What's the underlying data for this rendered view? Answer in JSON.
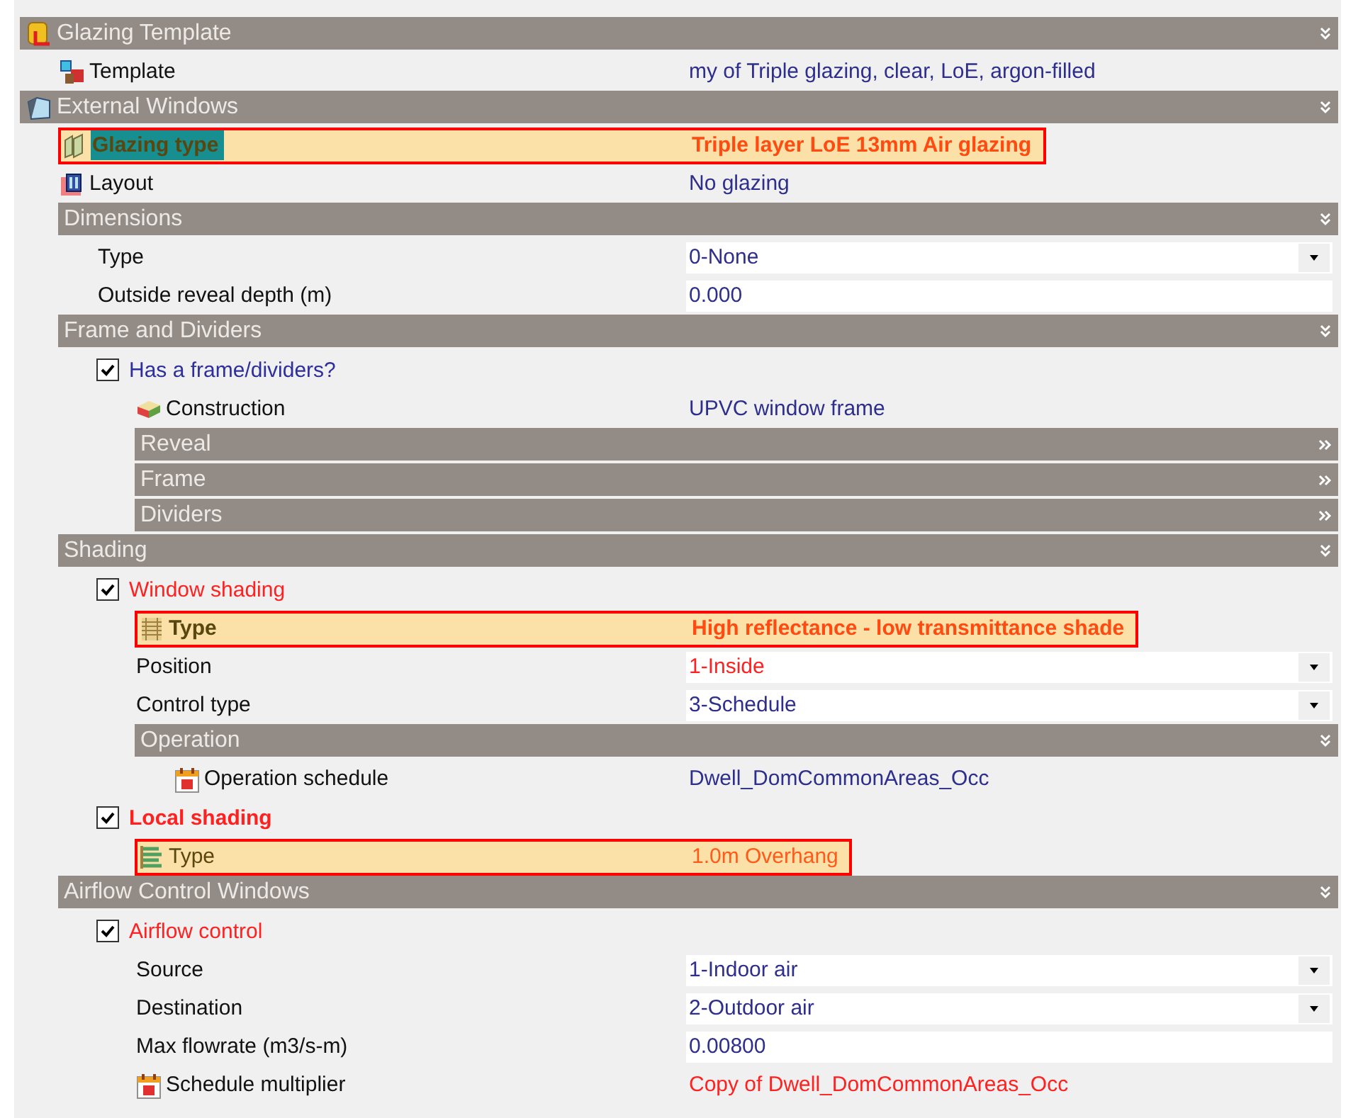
{
  "rows": [
    {
      "kind": "header",
      "label": "Glazing Template",
      "expanded": true,
      "children": [
        {
          "kind": "field",
          "label": "Template",
          "value": "my of Triple glazing, clear, LoE, argon-filled",
          "color": "#2e2e8c",
          "highlighted": false,
          "bold": false
        }
      ]
    },
    {
      "kind": "header",
      "label": "External Windows",
      "expanded": true,
      "children": [
        {
          "kind": "field",
          "label": "Glazing type",
          "value": "Triple layer LoE 13mm Air glazing",
          "color": "#ff4a10",
          "highlighted": true,
          "bold": true,
          "label_selected": true
        },
        {
          "kind": "field",
          "label": "Layout",
          "value": "No glazing",
          "color": "#2e2e8c",
          "highlighted": false,
          "bold": false
        },
        {
          "kind": "header",
          "label": "Dimensions",
          "expanded": true,
          "children": [
            {
              "kind": "dropdown",
              "label": "Type",
              "value": "0-None",
              "color": "#2e2e8c"
            },
            {
              "kind": "input",
              "label": "Outside reveal depth (m)",
              "value": "0.000",
              "color": "#2e2e8c"
            }
          ]
        },
        {
          "kind": "header",
          "label": "Frame and Dividers",
          "expanded": true,
          "children": [
            {
              "kind": "checkbox",
              "label": "Has a frame/dividers?",
              "checked": true,
              "color": "#2e2e9c",
              "bold": false,
              "children": [
                {
                  "kind": "field",
                  "label": "Construction",
                  "value": "UPVC window frame",
                  "color": "#2e2e8c",
                  "highlighted": false,
                  "bold": false
                },
                {
                  "kind": "header",
                  "label": "Reveal",
                  "expanded": false
                },
                {
                  "kind": "header",
                  "label": "Frame",
                  "expanded": false
                },
                {
                  "kind": "header",
                  "label": "Dividers",
                  "expanded": false
                }
              ]
            }
          ]
        },
        {
          "kind": "header",
          "label": "Shading",
          "expanded": true,
          "children": [
            {
              "kind": "checkbox",
              "label": "Window shading",
              "checked": true,
              "color": "#ff2020",
              "bold": false,
              "children": [
                {
                  "kind": "field",
                  "label": "Type",
                  "value": "High reflectance - low transmittance shade",
                  "color": "#ff4a10",
                  "highlighted": true,
                  "bold": true
                },
                {
                  "kind": "dropdown",
                  "label": "Position",
                  "value": "1-Inside",
                  "color": "#ff2020"
                },
                {
                  "kind": "dropdown",
                  "label": "Control type",
                  "value": "3-Schedule",
                  "color": "#2e2e8c"
                },
                {
                  "kind": "header",
                  "label": "Operation",
                  "expanded": true,
                  "children": [
                    {
                      "kind": "field",
                      "label": "Operation schedule",
                      "value": "Dwell_DomCommonAreas_Occ",
                      "color": "#2e2e8c",
                      "highlighted": false,
                      "bold": false
                    }
                  ]
                }
              ]
            },
            {
              "kind": "checkbox",
              "label": "Local shading",
              "checked": true,
              "color": "#ff2020",
              "bold": true,
              "children": [
                {
                  "kind": "field",
                  "label": "Type",
                  "value": "1.0m Overhang",
                  "color": "#ff5a1a",
                  "highlighted": true,
                  "bold": false
                }
              ]
            }
          ]
        },
        {
          "kind": "header",
          "label": "Airflow Control Windows",
          "expanded": true,
          "children": [
            {
              "kind": "checkbox",
              "label": "Airflow control",
              "checked": true,
              "color": "#ff2020",
              "bold": false,
              "children": [
                {
                  "kind": "dropdown",
                  "label": "Source",
                  "value": "1-Indoor air",
                  "color": "#2e2e8c"
                },
                {
                  "kind": "dropdown",
                  "label": "Destination",
                  "value": "2-Outdoor air",
                  "color": "#2e2e8c"
                },
                {
                  "kind": "input",
                  "label": "Max flowrate (m3/s-m)",
                  "value": "0.00800",
                  "color": "#2e2e8c"
                },
                {
                  "kind": "field",
                  "label": "Schedule multiplier",
                  "value": "Copy of Dwell_DomCommonAreas_Occ",
                  "color": "#ff2020",
                  "highlighted": false,
                  "bold": false
                }
              ]
            }
          ]
        }
      ]
    }
  ]
}
